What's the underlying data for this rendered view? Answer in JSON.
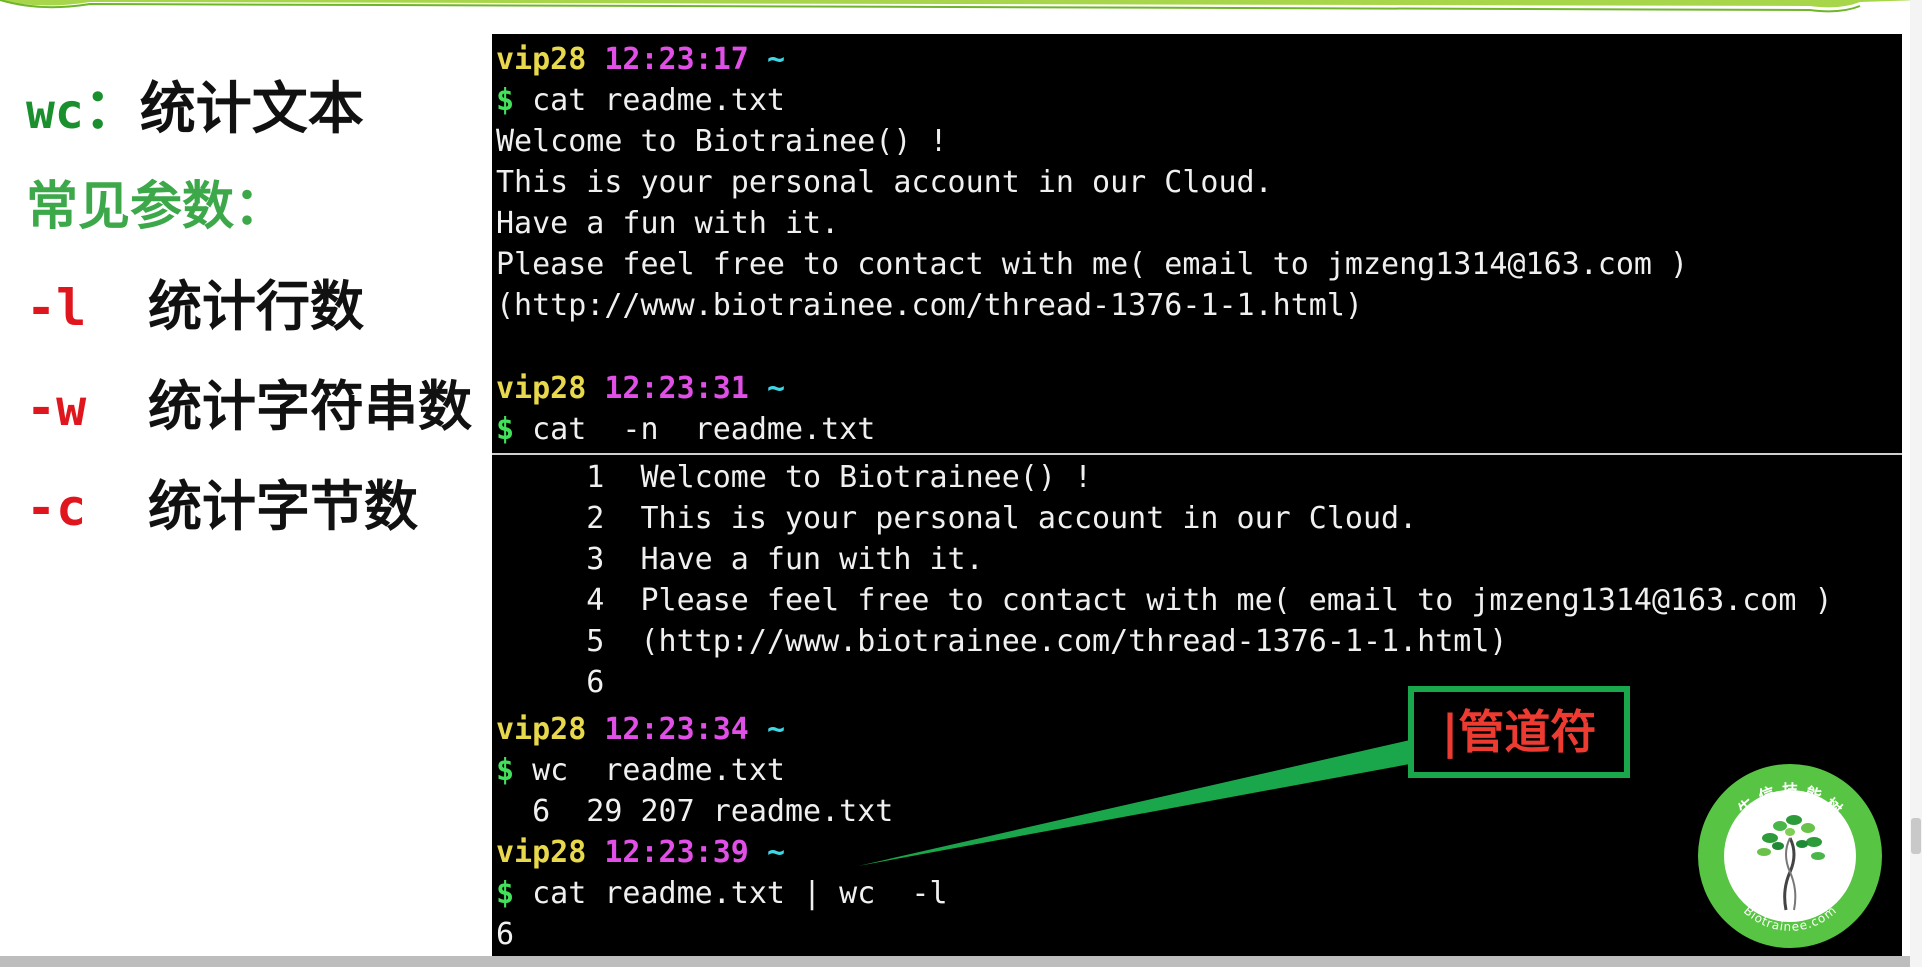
{
  "slide": {
    "title_cmd": "wc",
    "title_colon": "：",
    "title_desc": "统计文本",
    "params_heading": "常见参数：",
    "params": [
      {
        "flag": "-l",
        "desc": "统计行数"
      },
      {
        "flag": "-w",
        "desc": "统计字符串数"
      },
      {
        "flag": "-c",
        "desc": "统计字节数"
      }
    ]
  },
  "terminal": {
    "user": "vip28",
    "tilde": "~",
    "dollar": "$",
    "blocks": [
      {
        "time": "12:23:17",
        "command": "cat readme.txt"
      },
      {
        "time": "12:23:31",
        "command": "cat  -n  readme.txt"
      },
      {
        "time": "12:23:34",
        "command": "wc  readme.txt"
      },
      {
        "time": "12:23:39",
        "command": "cat readme.txt | wc  -l"
      }
    ],
    "output1": [
      "Welcome to Biotrainee() !",
      "This is your personal account in our Cloud.",
      "Have a fun with it.",
      "Please feel free to contact with me( email to jmzeng1314@163.com )",
      "(http://www.biotrainee.com/thread-1376-1-1.html)"
    ],
    "output2": [
      "     1  Welcome to Biotrainee() !",
      "     2  This is your personal account in our Cloud.",
      "     3  Have a fun with it.",
      "     4  Please feel free to contact with me( email to jmzeng1314@163.com )",
      "     5  (http://www.biotrainee.com/thread-1376-1-1.html)",
      "     6"
    ],
    "output3": "  6  29 207 readme.txt",
    "output4": "6"
  },
  "callout": {
    "text": "|管道符"
  },
  "logo": {
    "top_text": "生 信 技 能 树",
    "bottom_text": "Biotrainee.com"
  },
  "colors": {
    "green_title": "#1a8f2e",
    "flag_red": "#e0161e",
    "callout_border": "#1aa64a",
    "callout_text": "#ee3b32"
  }
}
